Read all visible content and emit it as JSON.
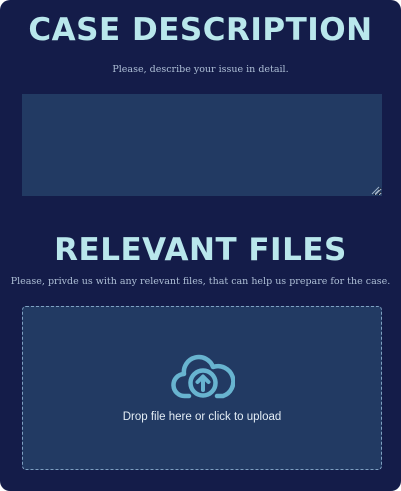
{
  "case_description": {
    "heading": "CASE DESCRIPTION",
    "subtitle": "Please, describe your issue in detail.",
    "textarea_value": ""
  },
  "relevant_files": {
    "heading": "RELEVANT FILES",
    "subtitle": "Please, privde us with any relevant files, that can help us prepare for the case.",
    "dropzone_label": "Drop file here or click to upload",
    "dropzone_icon": "cloud-upload-icon"
  },
  "colors": {
    "background": "#141c49",
    "heading": "#b9e7ec",
    "field": "#223a63",
    "icon": "#68b4d0"
  }
}
